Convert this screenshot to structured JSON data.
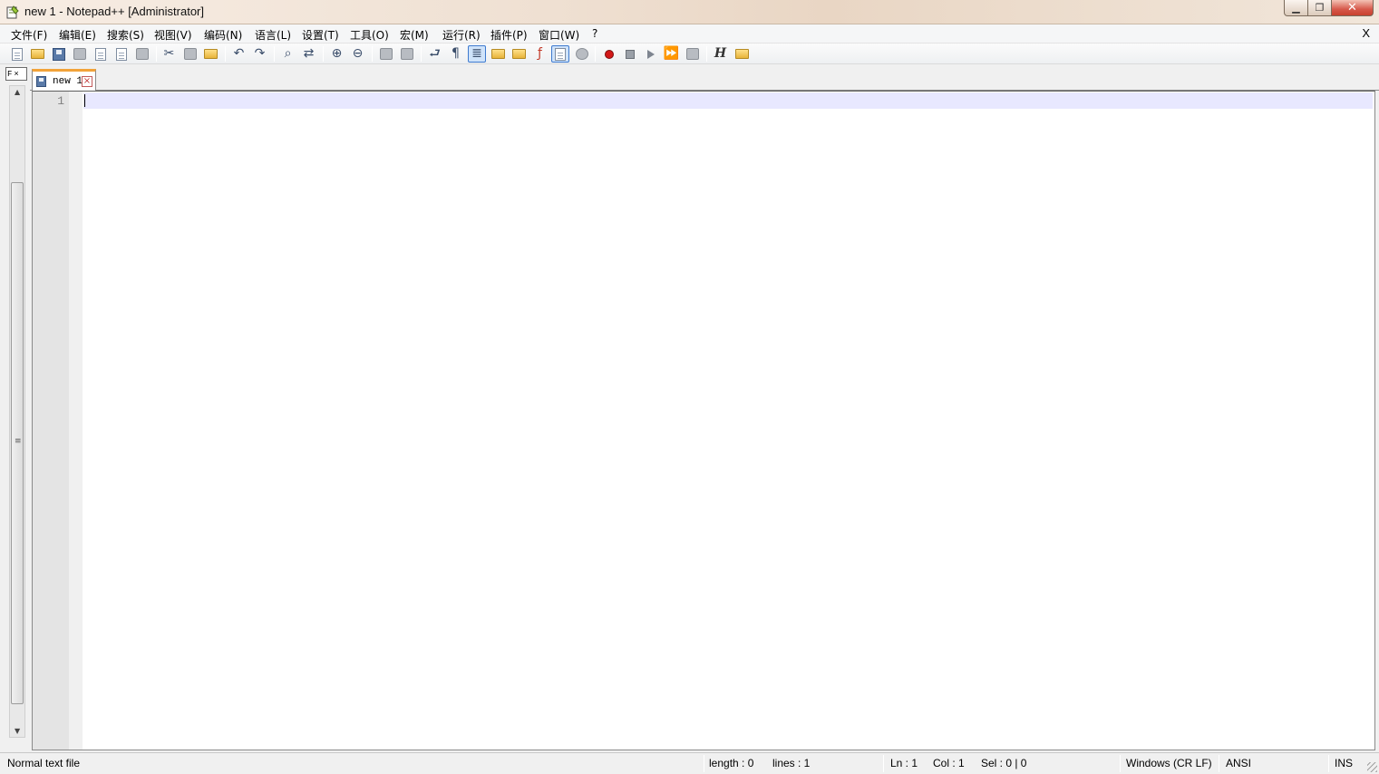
{
  "window": {
    "title": "new 1 - Notepad++ [Administrator]",
    "controls": [
      "minimize",
      "maximize",
      "close"
    ]
  },
  "menubar": {
    "items": [
      "文件(F)",
      "编辑(E)",
      "搜索(S)",
      "视图(V)",
      "编码(N)",
      "语言(L)",
      "设置(T)",
      "工具(O)",
      "宏(M)",
      "运行(R)",
      "插件(P)",
      "窗口(W)",
      "?"
    ],
    "close_label": "X"
  },
  "toolbar": {
    "icons": [
      "new-file-icon",
      "open-file-icon",
      "save-icon",
      "save-all-icon",
      "close-icon",
      "close-all-icon",
      "print-icon",
      "cut-icon",
      "copy-icon",
      "paste-icon",
      "undo-icon",
      "redo-icon",
      "find-icon",
      "replace-icon",
      "zoom-in-icon",
      "zoom-out-icon",
      "sync-vertical-icon",
      "sync-horizontal-icon",
      "word-wrap-icon",
      "show-all-chars-icon",
      "indent-guide-icon",
      "user-language-icon",
      "doc-map-icon",
      "function-list-icon",
      "folder-workspace-icon",
      "monitoring-icon",
      "record-macro-icon",
      "stop-record-icon",
      "play-macro-icon",
      "run-macro-multiple-icon",
      "save-macro-icon",
      "hex-editor-icon",
      "explorer-icon"
    ],
    "hex_label": "H"
  },
  "sidepanel": {
    "header_label": "F",
    "close_label": "×"
  },
  "tabs": [
    {
      "label": "new 1",
      "close_label": "×"
    }
  ],
  "editor": {
    "line_numbers": [
      "1"
    ],
    "current_line_color": "#e8e8ff",
    "gutter_color": "#e4e4e4"
  },
  "statusbar": {
    "file_type": "Normal text file",
    "length": "length : 0",
    "lines": "lines : 1",
    "ln": "Ln : 1",
    "col": "Col : 1",
    "sel": "Sel : 0 | 0",
    "eol": "Windows (CR LF)",
    "encoding": "ANSI",
    "mode": "INS"
  },
  "colors": {
    "tab_accent": "#f2a33a",
    "pressed_button": "#cfe3fa"
  }
}
